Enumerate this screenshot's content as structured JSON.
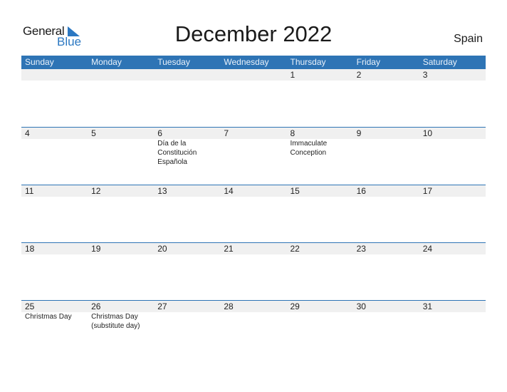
{
  "logo": {
    "word1": "General",
    "word2": "Blue",
    "icon": "triangle-flag-icon",
    "accent": "#2b78c2"
  },
  "title": "December 2022",
  "country": "Spain",
  "colors": {
    "header_bg": "#2e74b5",
    "row_strip": "#f0f0f0"
  },
  "weekdays": [
    "Sunday",
    "Monday",
    "Tuesday",
    "Wednesday",
    "Thursday",
    "Friday",
    "Saturday"
  ],
  "weeks": [
    [
      {
        "day": "",
        "event": ""
      },
      {
        "day": "",
        "event": ""
      },
      {
        "day": "",
        "event": ""
      },
      {
        "day": "",
        "event": ""
      },
      {
        "day": "1",
        "event": ""
      },
      {
        "day": "2",
        "event": ""
      },
      {
        "day": "3",
        "event": ""
      }
    ],
    [
      {
        "day": "4",
        "event": ""
      },
      {
        "day": "5",
        "event": ""
      },
      {
        "day": "6",
        "event": "Día de la\nConstitución\nEspañola"
      },
      {
        "day": "7",
        "event": ""
      },
      {
        "day": "8",
        "event": "Immaculate\nConception"
      },
      {
        "day": "9",
        "event": ""
      },
      {
        "day": "10",
        "event": ""
      }
    ],
    [
      {
        "day": "11",
        "event": ""
      },
      {
        "day": "12",
        "event": ""
      },
      {
        "day": "13",
        "event": ""
      },
      {
        "day": "14",
        "event": ""
      },
      {
        "day": "15",
        "event": ""
      },
      {
        "day": "16",
        "event": ""
      },
      {
        "day": "17",
        "event": ""
      }
    ],
    [
      {
        "day": "18",
        "event": ""
      },
      {
        "day": "19",
        "event": ""
      },
      {
        "day": "20",
        "event": ""
      },
      {
        "day": "21",
        "event": ""
      },
      {
        "day": "22",
        "event": ""
      },
      {
        "day": "23",
        "event": ""
      },
      {
        "day": "24",
        "event": ""
      }
    ],
    [
      {
        "day": "25",
        "event": "Christmas Day"
      },
      {
        "day": "26",
        "event": "Christmas Day\n(substitute day)"
      },
      {
        "day": "27",
        "event": ""
      },
      {
        "day": "28",
        "event": ""
      },
      {
        "day": "29",
        "event": ""
      },
      {
        "day": "30",
        "event": ""
      },
      {
        "day": "31",
        "event": ""
      }
    ]
  ]
}
